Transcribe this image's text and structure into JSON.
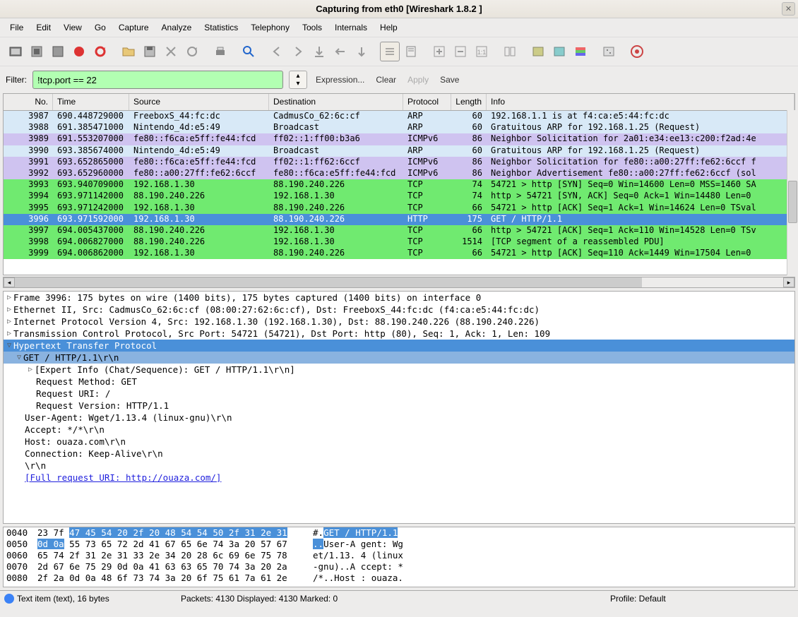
{
  "window": {
    "title": "Capturing from eth0    [Wireshark 1.8.2 ]"
  },
  "menu": [
    "File",
    "Edit",
    "View",
    "Go",
    "Capture",
    "Analyze",
    "Statistics",
    "Telephony",
    "Tools",
    "Internals",
    "Help"
  ],
  "filter": {
    "label": "Filter:",
    "value": "!tcp.port == 22",
    "expression": "Expression...",
    "clear": "Clear",
    "apply": "Apply",
    "save": "Save"
  },
  "columns": [
    "No.",
    "Time",
    "Source",
    "Destination",
    "Protocol",
    "Length",
    "Info"
  ],
  "packets": [
    {
      "no": "3987",
      "time": "690.448729000",
      "src": "FreeboxS_44:fc:dc",
      "dst": "CadmusCo_62:6c:cf",
      "proto": "ARP",
      "len": "60",
      "info": "192.168.1.1 is at f4:ca:e5:44:fc:dc",
      "bg": "#d8e9f7"
    },
    {
      "no": "3988",
      "time": "691.385471000",
      "src": "Nintendo_4d:e5:49",
      "dst": "Broadcast",
      "proto": "ARP",
      "len": "60",
      "info": "Gratuitous ARP for 192.168.1.25 (Request)",
      "bg": "#d8e9f7"
    },
    {
      "no": "3989",
      "time": "691.553207000",
      "src": "fe80::f6ca:e5ff:fe44:fcd",
      "dst": "ff02::1:ff00:b3a6",
      "proto": "ICMPv6",
      "len": "86",
      "info": "Neighbor Solicitation for 2a01:e34:ee13:c200:f2ad:4e",
      "bg": "#cfc3f0"
    },
    {
      "no": "3990",
      "time": "693.385674000",
      "src": "Nintendo_4d:e5:49",
      "dst": "Broadcast",
      "proto": "ARP",
      "len": "60",
      "info": "Gratuitous ARP for 192.168.1.25 (Request)",
      "bg": "#d8e9f7"
    },
    {
      "no": "3991",
      "time": "693.652865000",
      "src": "fe80::f6ca:e5ff:fe44:fcd",
      "dst": "ff02::1:ff62:6ccf",
      "proto": "ICMPv6",
      "len": "86",
      "info": "Neighbor Solicitation for fe80::a00:27ff:fe62:6ccf f",
      "bg": "#cfc3f0"
    },
    {
      "no": "3992",
      "time": "693.652960000",
      "src": "fe80::a00:27ff:fe62:6ccf",
      "dst": "fe80::f6ca:e5ff:fe44:fcd",
      "proto": "ICMPv6",
      "len": "86",
      "info": "Neighbor Advertisement fe80::a00:27ff:fe62:6ccf (sol",
      "bg": "#cfc3f0"
    },
    {
      "no": "3993",
      "time": "693.940709000",
      "src": "192.168.1.30",
      "dst": "88.190.240.226",
      "proto": "TCP",
      "len": "74",
      "info": "54721 > http [SYN] Seq=0 Win=14600 Len=0 MSS=1460 SA",
      "bg": "#70ea70"
    },
    {
      "no": "3994",
      "time": "693.971142000",
      "src": "88.190.240.226",
      "dst": "192.168.1.30",
      "proto": "TCP",
      "len": "74",
      "info": "http > 54721 [SYN, ACK] Seq=0 Ack=1 Win=14480 Len=0 ",
      "bg": "#70ea70"
    },
    {
      "no": "3995",
      "time": "693.971242000",
      "src": "192.168.1.30",
      "dst": "88.190.240.226",
      "proto": "TCP",
      "len": "66",
      "info": "54721 > http [ACK] Seq=1 Ack=1 Win=14624 Len=0 TSval",
      "bg": "#70ea70"
    },
    {
      "no": "3996",
      "time": "693.971592000",
      "src": "192.168.1.30",
      "dst": "88.190.240.226",
      "proto": "HTTP",
      "len": "175",
      "info": "GET / HTTP/1.1",
      "bg": "#4a90d9",
      "fg": "#fff",
      "sel": true
    },
    {
      "no": "3997",
      "time": "694.005437000",
      "src": "88.190.240.226",
      "dst": "192.168.1.30",
      "proto": "TCP",
      "len": "66",
      "info": "http > 54721 [ACK] Seq=1 Ack=110 Win=14528 Len=0 TSv",
      "bg": "#70ea70"
    },
    {
      "no": "3998",
      "time": "694.006827000",
      "src": "88.190.240.226",
      "dst": "192.168.1.30",
      "proto": "TCP",
      "len": "1514",
      "info": "[TCP segment of a reassembled PDU]",
      "bg": "#70ea70"
    },
    {
      "no": "3999",
      "time": "694.006862000",
      "src": "192.168.1.30",
      "dst": "88.190.240.226",
      "proto": "TCP",
      "len": "66",
      "info": "54721 > http [ACK] Seq=110 Ack=1449 Win=17504 Len=0 ",
      "bg": "#70ea70"
    }
  ],
  "details": {
    "frame": "Frame 3996: 175 bytes on wire (1400 bits), 175 bytes captured (1400 bits) on interface 0",
    "eth": "Ethernet II, Src: CadmusCo_62:6c:cf (08:00:27:62:6c:cf), Dst: FreeboxS_44:fc:dc (f4:ca:e5:44:fc:dc)",
    "ip": "Internet Protocol Version 4, Src: 192.168.1.30 (192.168.1.30), Dst: 88.190.240.226 (88.190.240.226)",
    "tcp": "Transmission Control Protocol, Src Port: 54721 (54721), Dst Port: http (80), Seq: 1, Ack: 1, Len: 109",
    "http": "Hypertext Transfer Protocol",
    "get": "GET / HTTP/1.1\\r\\n",
    "expert": "[Expert Info (Chat/Sequence): GET / HTTP/1.1\\r\\n]",
    "method": "Request Method: GET",
    "uri": "Request URI: /",
    "version": "Request Version: HTTP/1.1",
    "ua": "User-Agent: Wget/1.13.4 (linux-gnu)\\r\\n",
    "accept": "Accept: */*\\r\\n",
    "host": "Host: ouaza.com\\r\\n",
    "conn": "Connection: Keep-Alive\\r\\n",
    "crlf": "\\r\\n",
    "fulluri": "[Full request URI: http://ouaza.com/]"
  },
  "hex": [
    {
      "off": "0040",
      "b": "23 7f ",
      "hb": "47 45 54 20 2f 20  48 54 54 50 2f 31 2e 31",
      "a": "#.",
      "ha": "GET /  HTTP/1.1"
    },
    {
      "off": "0050",
      "b": "",
      "hb": "0d 0a",
      "b2": " 55 73 65 72 2d 41  67 65 6e 74 3a 20 57 67",
      "a": "",
      "ha": "..",
      "a2": "User-A gent: Wg"
    },
    {
      "off": "0060",
      "b": "65 74 2f 31 2e 31 33 2e  34 20 28 6c 69 6e 75 78",
      "a": "et/1.13. 4 (linux"
    },
    {
      "off": "0070",
      "b": "2d 67 6e 75 29 0d 0a 41  63 63 65 70 74 3a 20 2a",
      "a": "-gnu)..A ccept: *"
    },
    {
      "off": "0080",
      "b": "2f 2a 0d 0a 48 6f 73 74  3a 20 6f 75 61 7a 61 2e",
      "a": "/*..Host : ouaza."
    }
  ],
  "status": {
    "left": "Text item (text), 16 bytes",
    "mid": "Packets: 4130 Displayed: 4130 Marked: 0",
    "right": "Profile: Default"
  }
}
